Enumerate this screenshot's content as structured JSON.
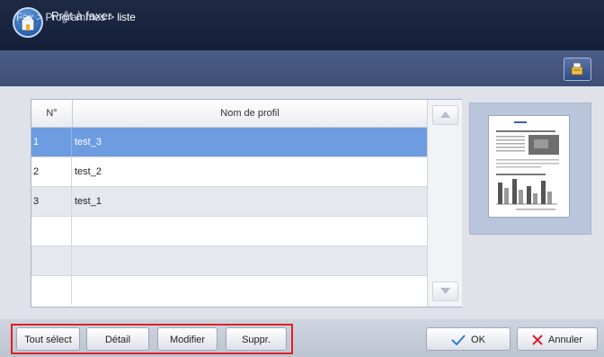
{
  "header": {
    "status": "Prêt à faxer"
  },
  "breadcrumb": {
    "path": "Fax > Programmes > ",
    "current": "liste"
  },
  "table": {
    "columns": [
      "N°",
      "Nom de profil"
    ],
    "rows": [
      {
        "no": "1",
        "name": "test_3",
        "selected": true
      },
      {
        "no": "2",
        "name": "test_2",
        "selected": false
      },
      {
        "no": "3",
        "name": "test_1",
        "selected": false
      },
      {
        "no": "",
        "name": "",
        "selected": false
      },
      {
        "no": "",
        "name": "",
        "selected": false
      },
      {
        "no": "",
        "name": "",
        "selected": false
      }
    ]
  },
  "actions": {
    "select_all": "Tout sélect",
    "detail": "Détail",
    "modify": "Modifier",
    "delete": "Suppr.",
    "ok": "OK",
    "cancel": "Annuler"
  },
  "icons": {
    "home": "home-icon",
    "breadcrumb_button": "job-status-icon",
    "scroll_up": "arrow-up-icon",
    "scroll_down": "arrow-down-icon",
    "ok": "checkmark-icon",
    "cancel": "x-icon"
  },
  "colors": {
    "selected_row": "#6d9de0",
    "highlight_box": "#e02024",
    "ok_check": "#2a7fd6",
    "cancel_x": "#d8202a"
  }
}
